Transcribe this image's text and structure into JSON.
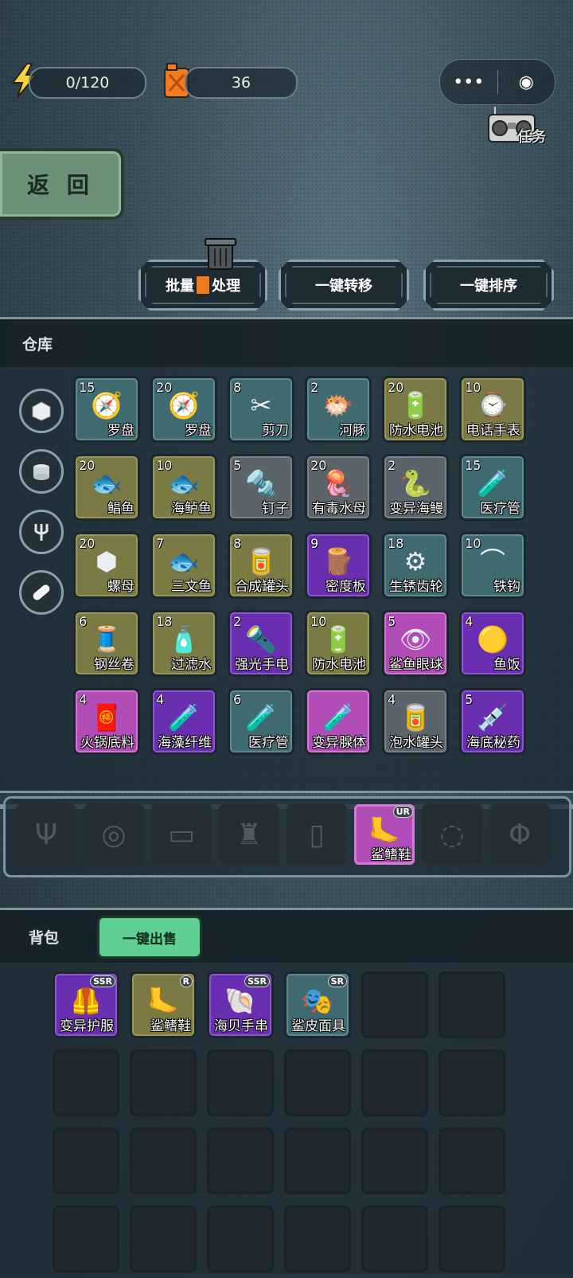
{
  "resources": {
    "energy": "0/120",
    "fuel": "36"
  },
  "capsule": {
    "more": "•••",
    "close": "◉"
  },
  "task_label": "任务",
  "back_label": "返 回",
  "actions": {
    "batch": "批量",
    "batch2": "处理",
    "transfer": "一键转移",
    "sort": "一键排序"
  },
  "warehouse": {
    "title": "仓库",
    "categories": [
      "box-icon",
      "can-icon",
      "fork-icon",
      "pill-icon"
    ],
    "items": [
      {
        "count": "15",
        "name": "罗盘",
        "color": "teal",
        "icon": "🧭"
      },
      {
        "count": "20",
        "name": "罗盘",
        "color": "teal",
        "icon": "🧭"
      },
      {
        "count": "8",
        "name": "剪刀",
        "color": "teal",
        "icon": "✂"
      },
      {
        "count": "2",
        "name": "河豚",
        "color": "teal",
        "icon": "🐡"
      },
      {
        "count": "20",
        "name": "防水电池",
        "color": "olive",
        "icon": "🔋"
      },
      {
        "count": "10",
        "name": "电话手表",
        "color": "olive",
        "icon": "⌚"
      },
      {
        "count": "20",
        "name": "鲳鱼",
        "color": "olive",
        "icon": "🐟"
      },
      {
        "count": "10",
        "name": "海鲈鱼",
        "color": "olive",
        "icon": "🐟"
      },
      {
        "count": "5",
        "name": "钉子",
        "color": "gray",
        "icon": "🔩"
      },
      {
        "count": "20",
        "name": "有毒水母",
        "color": "gray",
        "icon": "🪼"
      },
      {
        "count": "2",
        "name": "变异海鳗",
        "color": "gray",
        "icon": "🐍"
      },
      {
        "count": "15",
        "name": "医疗管",
        "color": "teal",
        "icon": "🧪"
      },
      {
        "count": "20",
        "name": "螺母",
        "color": "olive",
        "icon": "⬢"
      },
      {
        "count": "7",
        "name": "三文鱼",
        "color": "olive",
        "icon": "🐟"
      },
      {
        "count": "8",
        "name": "合成罐头",
        "color": "olive",
        "icon": "🥫"
      },
      {
        "count": "9",
        "name": "密度板",
        "color": "purple",
        "icon": "🪵"
      },
      {
        "count": "18",
        "name": "生锈齿轮",
        "color": "teal",
        "icon": "⚙"
      },
      {
        "count": "10",
        "name": "铁钩",
        "color": "teal",
        "icon": "⌒"
      },
      {
        "count": "6",
        "name": "钢丝卷",
        "color": "olive",
        "icon": "🧵"
      },
      {
        "count": "18",
        "name": "过滤水",
        "color": "olive",
        "icon": "🧴"
      },
      {
        "count": "2",
        "name": "强光手电",
        "color": "purple",
        "icon": "🔦"
      },
      {
        "count": "10",
        "name": "防水电池",
        "color": "olive",
        "icon": "🔋"
      },
      {
        "count": "5",
        "name": "鲨鱼眼球",
        "color": "pink",
        "icon": "👁"
      },
      {
        "count": "4",
        "name": "鱼饭",
        "color": "purple",
        "icon": "🟡"
      },
      {
        "count": "4",
        "name": "火锅底料",
        "color": "pink",
        "icon": "🧧"
      },
      {
        "count": "4",
        "name": "海藻纤维",
        "color": "purple",
        "icon": "🧪"
      },
      {
        "count": "6",
        "name": "医疗管",
        "color": "teal",
        "icon": "🧪"
      },
      {
        "count": "",
        "name": "变异腺体",
        "color": "pink",
        "icon": "🧪"
      },
      {
        "count": "4",
        "name": "泡水罐头",
        "color": "gray",
        "icon": "🥫"
      },
      {
        "count": "5",
        "name": "海底秘药",
        "color": "purple",
        "icon": "💉"
      }
    ]
  },
  "equipment": [
    {
      "icon": "trident-icon",
      "glyph": "Ψ",
      "name": "",
      "rarity": ""
    },
    {
      "icon": "mask-icon",
      "glyph": "◎",
      "name": "",
      "rarity": ""
    },
    {
      "icon": "belt-icon",
      "glyph": "▭",
      "name": "",
      "rarity": ""
    },
    {
      "icon": "suit-icon",
      "glyph": "♜",
      "name": "",
      "rarity": ""
    },
    {
      "icon": "tank-icon",
      "glyph": "▯",
      "name": "",
      "rarity": ""
    },
    {
      "icon": "fins-icon",
      "glyph": "🦶",
      "name": "鲨鳍鞋",
      "rarity": "UR"
    },
    {
      "icon": "necklace-icon",
      "glyph": "◌",
      "name": "",
      "rarity": ""
    },
    {
      "icon": "phi-icon",
      "glyph": "Φ",
      "name": "",
      "rarity": ""
    }
  ],
  "backpack": {
    "title": "背包",
    "sell_label": "一键出售",
    "items": [
      {
        "name": "变异护服",
        "rarity": "SSR",
        "color": "purple",
        "icon": "🦺"
      },
      {
        "name": "鲨鳍鞋",
        "rarity": "R",
        "color": "olive",
        "icon": "🦶"
      },
      {
        "name": "海贝手串",
        "rarity": "SSR",
        "color": "purple",
        "icon": "🐚"
      },
      {
        "name": "鲨皮面具",
        "rarity": "SR",
        "color": "teal",
        "icon": "🎭"
      }
    ]
  }
}
